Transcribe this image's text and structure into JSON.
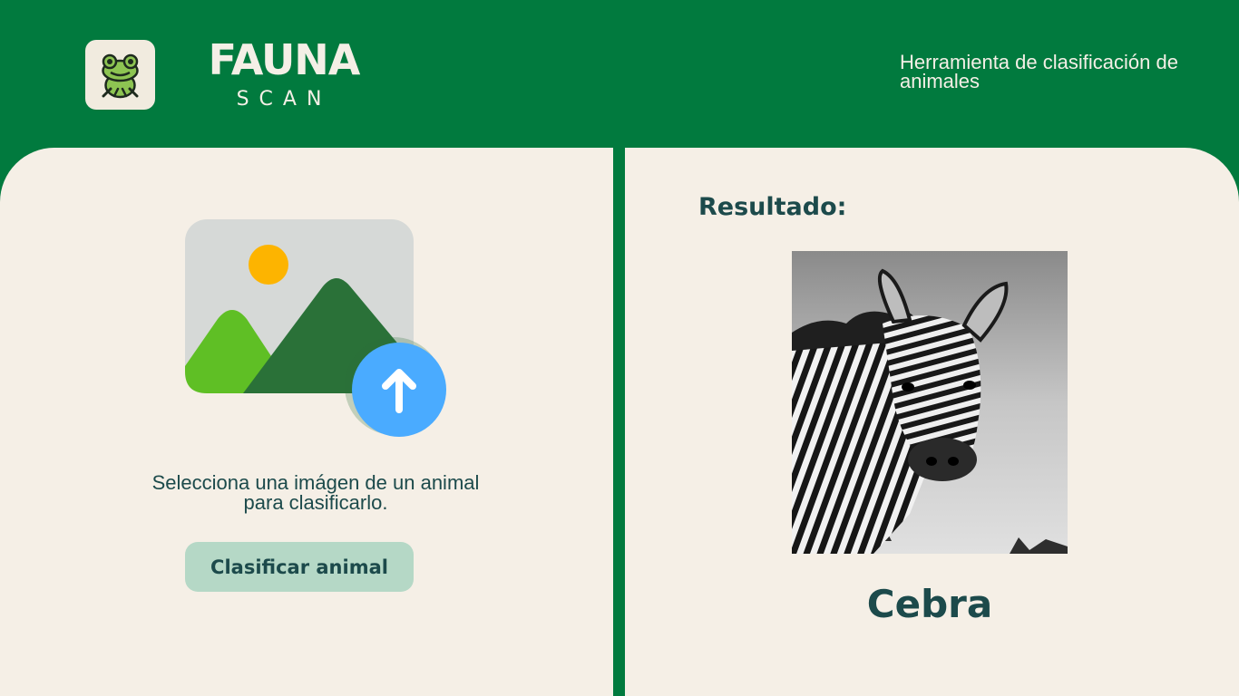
{
  "brand": {
    "title": "FAUNA",
    "subtitle": "SCAN",
    "logo_icon": "frog-icon"
  },
  "header": {
    "tagline": "Herramienta de clasificación de animales"
  },
  "upload": {
    "icon": "image-upload-icon",
    "instruction": "Selecciona una imágen de un animal para clasificarlo.",
    "button_label": "Clasificar animal"
  },
  "result": {
    "label": "Resultado:",
    "image_icon": "zebra-photo",
    "animal_name": "Cebra"
  },
  "colors": {
    "brand_green": "#017a3e",
    "panel_bg": "#f5efe6",
    "text_dark": "#1c4a4b",
    "button_bg": "#b5d8c6",
    "upload_blue": "#4aabff",
    "sun": "#fdb400"
  }
}
